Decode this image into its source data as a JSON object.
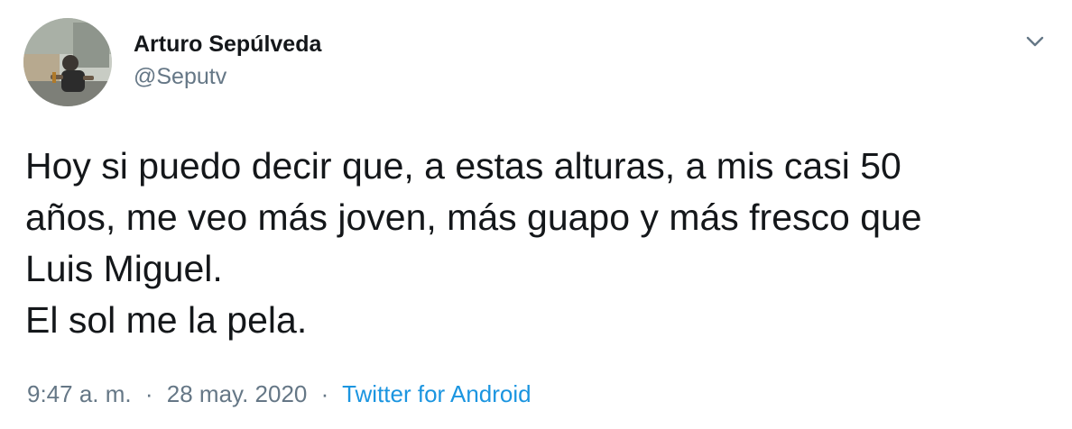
{
  "author": {
    "display_name": "Arturo Sepúlveda",
    "handle": "@Seputv"
  },
  "tweet": {
    "lines": [
      "Hoy si puedo decir que, a estas alturas, a mis casi 50",
      "años, me veo más joven, más guapo y más fresco que",
      "Luis Miguel.",
      "El sol me la pela."
    ]
  },
  "meta": {
    "time": "9:47 a. m.",
    "separator": "·",
    "date": "28 may. 2020",
    "source": "Twitter for Android"
  },
  "colors": {
    "text": "#14171a",
    "secondary": "#657786",
    "link": "#1b95e0"
  },
  "icons": {
    "menu": "chevron-down-icon"
  }
}
